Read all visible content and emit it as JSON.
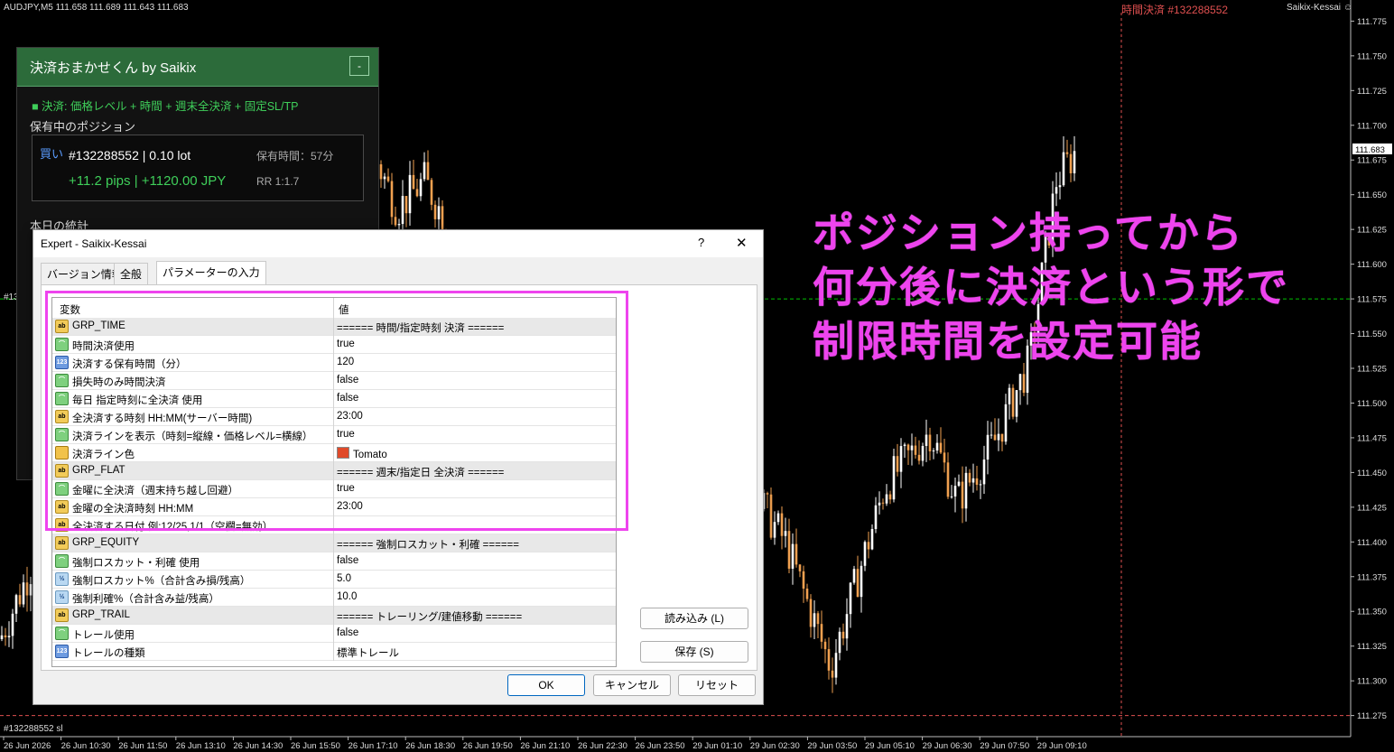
{
  "chart": {
    "symbol_info": "AUDJPY,M5  111.658 111.689 111.643 111.683",
    "close_label": "時間決済 #132288552",
    "broker": "Saikix-Kessai",
    "smiley_icon": "smiley-icon",
    "current_price": "111.683",
    "left_marker": "#13",
    "sl_label": "#132288552 sl",
    "price_axis": [
      "111.775",
      "111.750",
      "111.725",
      "111.700",
      "111.675",
      "111.650",
      "111.625",
      "111.600",
      "111.575",
      "111.550",
      "111.525",
      "111.500",
      "111.475",
      "111.450",
      "111.425",
      "111.400",
      "111.375",
      "111.350",
      "111.325",
      "111.300",
      "111.275"
    ],
    "time_axis": [
      "26 Jun 2026",
      "26 Jun 10:30",
      "26 Jun 11:50",
      "26 Jun 13:10",
      "26 Jun 14:30",
      "26 Jun 15:50",
      "26 Jun 17:10",
      "26 Jun 18:30",
      "26 Jun 19:50",
      "26 Jun 21:10",
      "26 Jun 22:30",
      "26 Jun 23:50",
      "29 Jun 01:10",
      "29 Jun 02:30",
      "29 Jun 03:50",
      "29 Jun 05:10",
      "29 Jun 06:30",
      "29 Jun 07:50",
      "29 Jun 09:10"
    ],
    "colors": {
      "bull": "#ffffff",
      "bear": "#f0a050",
      "close_line": "#e05050",
      "price_line": "#00c000"
    }
  },
  "panel": {
    "title": "決済おまかせくん by Saikix",
    "minimize": "-",
    "mode": "■ 決済: 価格レベル + 時間 + 週末全決済 + 固定SL/TP",
    "positions_title": "保有中のポジション",
    "side": "買い",
    "ticket_lot": "#132288552 | 0.10 lot",
    "hold_time": "保有時間：57分",
    "pnl": "+11.2 pips | +1120.00 JPY",
    "rr": "RR 1:1.7",
    "stats_title": "本日の統計"
  },
  "overlay": {
    "line1": "ポジション持ってから",
    "line2": "何分後に決済という形で",
    "line3": "制限時間を設定可能",
    "color": "#ee44ee"
  },
  "dialog": {
    "title": "Expert - Saikix-Kessai",
    "help": "?",
    "close": "✕",
    "tabs": [
      "バージョン情報",
      "全般",
      "パラメーターの入力"
    ],
    "col_name": "変数",
    "col_value": "値",
    "rows": [
      {
        "icon": "ab",
        "name": "GRP_TIME",
        "value": "====== 時間/指定時刻 決済 ======",
        "group": true
      },
      {
        "icon": "bool",
        "name": "時間決済使用",
        "value": "true"
      },
      {
        "icon": "num",
        "name": "決済する保有時間（分）",
        "value": "120"
      },
      {
        "icon": "bool",
        "name": "損失時のみ時間決済",
        "value": "false"
      },
      {
        "icon": "bool",
        "name": "毎日 指定時刻に全決済 使用",
        "value": "false"
      },
      {
        "icon": "ab",
        "name": "全決済する時刻 HH:MM(サーバー時間)",
        "value": "23:00"
      },
      {
        "icon": "bool",
        "name": "決済ラインを表示（時刻=縦線・価格レベル=横線）",
        "value": "true"
      },
      {
        "icon": "col",
        "name": "決済ライン色",
        "value": "Tomato",
        "swatch": "#e04a2a"
      },
      {
        "icon": "ab",
        "name": "GRP_FLAT",
        "value": "====== 週末/指定日 全決済 ======",
        "group": true
      },
      {
        "icon": "bool",
        "name": "金曜に全決済（週末持ち越し回避）",
        "value": "true"
      },
      {
        "icon": "ab",
        "name": "金曜の全決済時刻 HH:MM",
        "value": "23:00"
      },
      {
        "icon": "ab",
        "name": "全決済する日付 例:12/25,1/1（空欄=無効）",
        "value": ""
      },
      {
        "icon": "ab",
        "name": "GRP_EQUITY",
        "value": "====== 強制ロスカット・利確 ======",
        "group": true
      },
      {
        "icon": "bool",
        "name": "強制ロスカット・利確 使用",
        "value": "false"
      },
      {
        "icon": "dbl",
        "name": "強制ロスカット%（合計含み損/残高）",
        "value": "5.0"
      },
      {
        "icon": "dbl",
        "name": "強制利確%（合計含み益/残高）",
        "value": "10.0"
      },
      {
        "icon": "ab",
        "name": "GRP_TRAIL",
        "value": "====== トレーリング/建値移動 ======",
        "group": true
      },
      {
        "icon": "bool",
        "name": "トレール使用",
        "value": "false"
      },
      {
        "icon": "num",
        "name": "トレールの種類",
        "value": "標準トレール"
      }
    ],
    "icon_text": {
      "ab": "ab",
      "bool": "",
      "num": "123",
      "dbl": "½",
      "col": ""
    },
    "load_button": "読み込み (L)",
    "save_button": "保存 (S)",
    "ok_button": "OK",
    "cancel_button": "キャンセル",
    "reset_button": "リセット"
  }
}
